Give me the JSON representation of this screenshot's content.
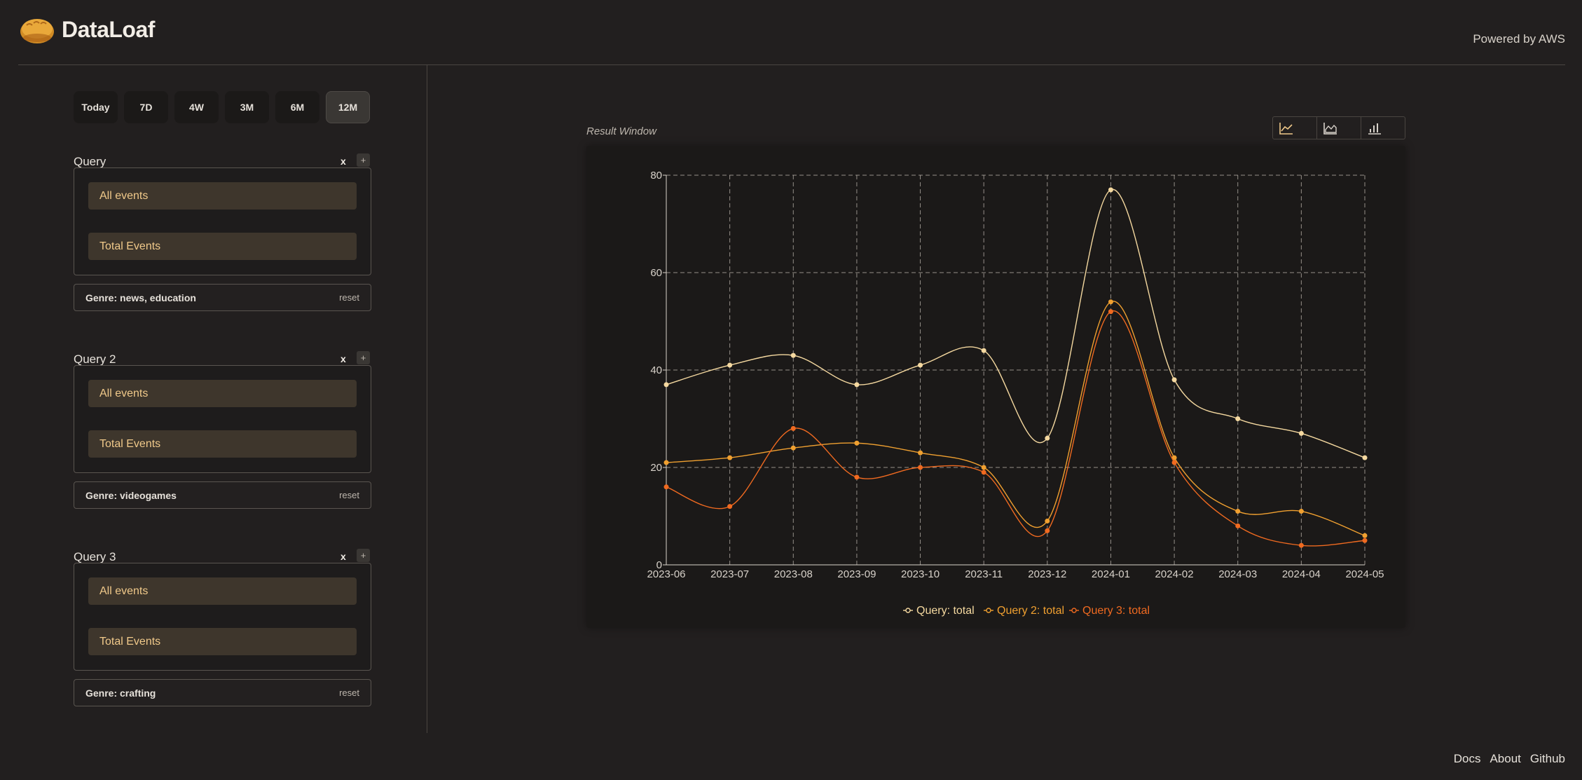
{
  "header": {
    "brand": "DataLoaf",
    "powered_by": "Powered by AWS"
  },
  "time_range": {
    "options": [
      "Today",
      "7D",
      "4W",
      "3M",
      "6M",
      "12M"
    ],
    "selected": "12M"
  },
  "queries": [
    {
      "title": "Query",
      "remove_label": "x",
      "add_label": "+",
      "event": "All events",
      "measure": "Total Events",
      "filter": "Genre: news, education",
      "reset_label": "reset"
    },
    {
      "title": "Query 2",
      "remove_label": "x",
      "add_label": "+",
      "event": "All events",
      "measure": "Total Events",
      "filter": "Genre: videogames",
      "reset_label": "reset"
    },
    {
      "title": "Query 3",
      "remove_label": "x",
      "add_label": "+",
      "event": "All events",
      "measure": "Total Events",
      "filter": "Genre: crafting",
      "reset_label": "reset"
    }
  ],
  "result": {
    "label": "Result Window",
    "chart_types": [
      {
        "icon": "line-chart-icon",
        "active": true
      },
      {
        "icon": "area-chart-icon",
        "active": false
      },
      {
        "icon": "bar-chart-icon",
        "active": false
      }
    ]
  },
  "chart_data": {
    "type": "line",
    "x": [
      "2023-06",
      "2023-07",
      "2023-08",
      "2023-09",
      "2023-10",
      "2023-11",
      "2023-12",
      "2024-01",
      "2024-02",
      "2024-03",
      "2024-04",
      "2024-05"
    ],
    "ylim": [
      0,
      80
    ],
    "yticks": [
      0,
      20,
      40,
      60,
      80
    ],
    "grid": true,
    "legend_position": "bottom-center",
    "series": [
      {
        "name": "Query: total",
        "color": "#f5d9a0",
        "values": [
          37,
          41,
          43,
          37,
          41,
          44,
          26,
          77,
          38,
          30,
          27,
          22
        ]
      },
      {
        "name": "Query 2: total",
        "color": "#f0a030",
        "values": [
          21,
          22,
          24,
          25,
          23,
          20,
          9,
          54,
          22,
          11,
          11,
          6
        ]
      },
      {
        "name": "Query 3: total",
        "color": "#f06a20",
        "values": [
          16,
          12,
          28,
          18,
          20,
          19,
          7,
          52,
          21,
          8,
          4,
          5
        ]
      }
    ]
  },
  "footer": {
    "links": [
      "Docs",
      "About",
      "Github"
    ]
  }
}
